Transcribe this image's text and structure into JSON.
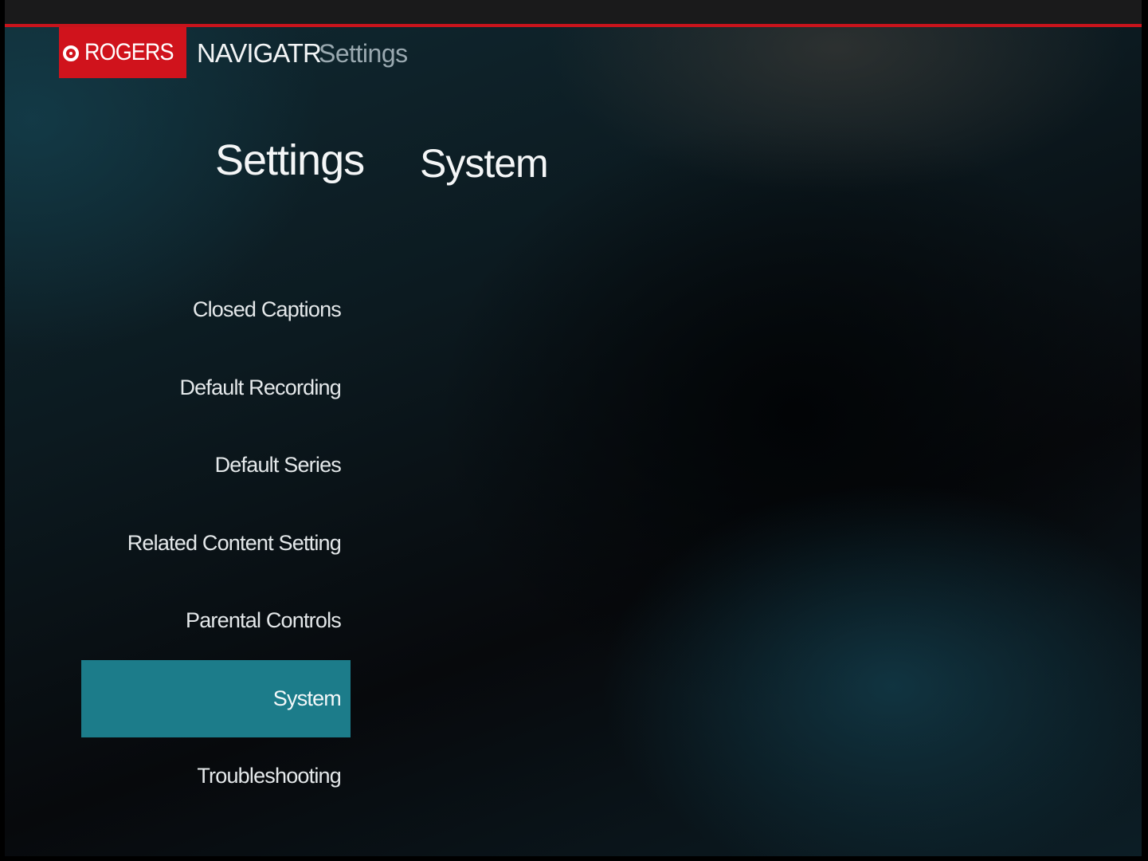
{
  "header": {
    "brand": "ROGERS",
    "product": "NAVIGATR",
    "section": "Settings"
  },
  "main": {
    "title": "Settings",
    "selected_section_title": "System"
  },
  "menu": {
    "items": [
      {
        "label": "Closed Captions",
        "selected": false
      },
      {
        "label": "Default Recording",
        "selected": false
      },
      {
        "label": "Default Series",
        "selected": false
      },
      {
        "label": "Related Content Setting",
        "selected": false
      },
      {
        "label": "Parental Controls",
        "selected": false
      },
      {
        "label": "System",
        "selected": true
      },
      {
        "label": "Troubleshooting",
        "selected": false
      }
    ]
  },
  "colors": {
    "brand_red": "#d0131c",
    "selection_teal": "#1c7c8a"
  },
  "icons": {
    "brand_logo": "rogers-logo-icon"
  }
}
